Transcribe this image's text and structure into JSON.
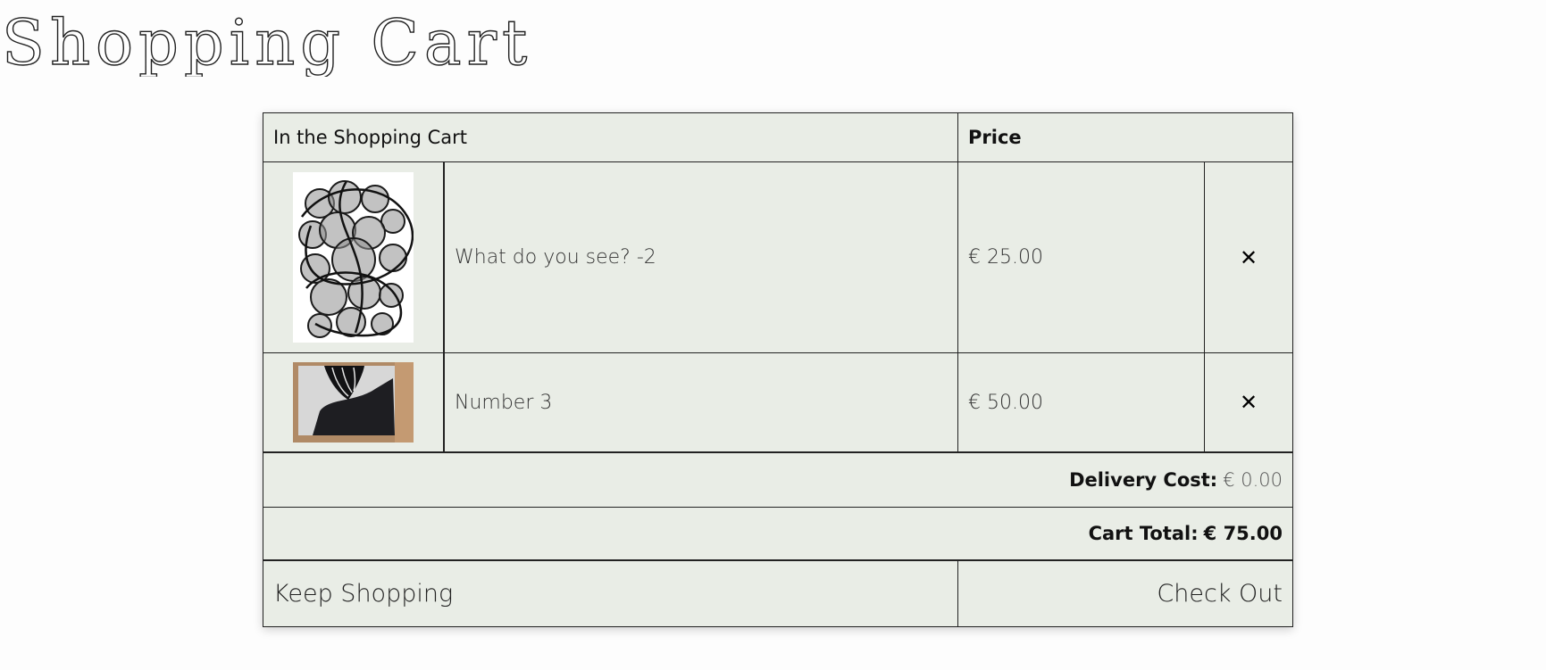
{
  "logo": {
    "text": "Shopping Cart"
  },
  "cart": {
    "header_title": "In the Shopping Cart",
    "header_price": "Price",
    "items": [
      {
        "name": "What do you see? -2",
        "price": "€ 25.00",
        "remove_icon": "✕"
      },
      {
        "name": "Number 3",
        "price": "€ 50.00",
        "remove_icon": "✕"
      }
    ],
    "delivery_label": "Delivery Cost:",
    "delivery_value": "€ 0.00",
    "total_label": "Cart Total:",
    "total_value": "€ 75.00",
    "keep_shopping": "Keep Shopping",
    "check_out": "Check Out"
  },
  "colors": {
    "panel_bg": "#e9ede6",
    "border": "#222222",
    "page_bg": "#fdfdfd"
  }
}
